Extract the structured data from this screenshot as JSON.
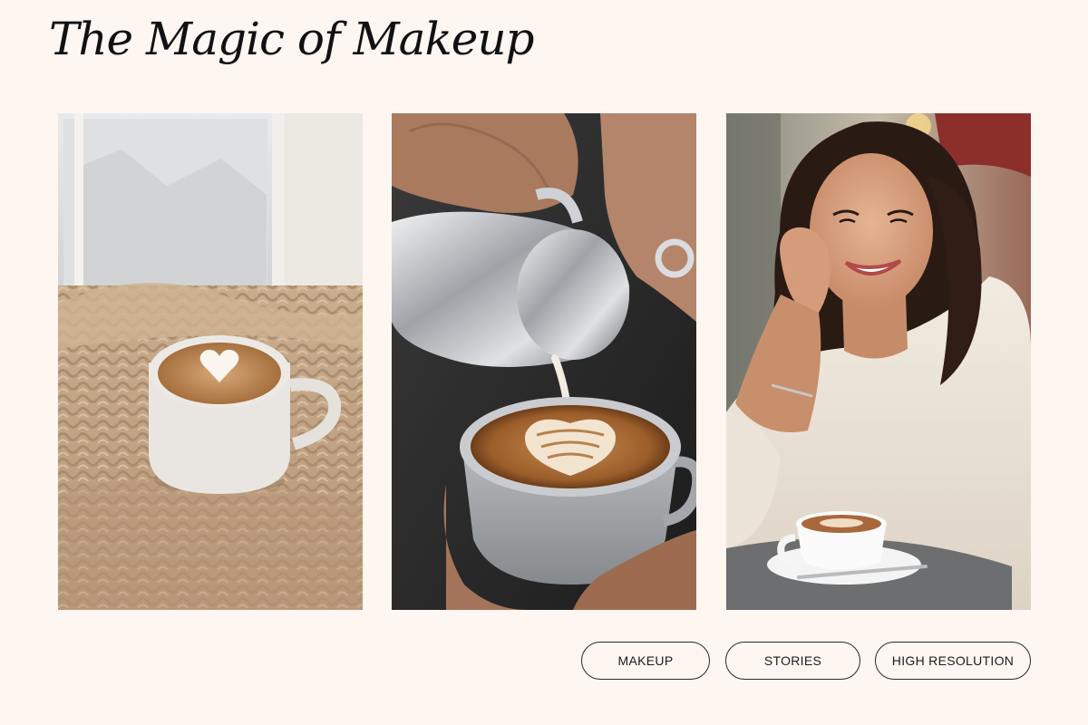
{
  "header": {
    "title": "The Magic of Makeup"
  },
  "gallery": {
    "photos": [
      {
        "subject": "latte with heart art on knitted blanket by window"
      },
      {
        "subject": "barista pouring latte art into grey cup"
      },
      {
        "subject": "smiling woman with cappuccino at cafe table"
      }
    ]
  },
  "tags": [
    "MAKEUP",
    "STORIES",
    "HIGH RESOLUTION"
  ],
  "colors": {
    "background": "#fdf6f1",
    "border": "#2a2a2a",
    "text": "#111111"
  }
}
